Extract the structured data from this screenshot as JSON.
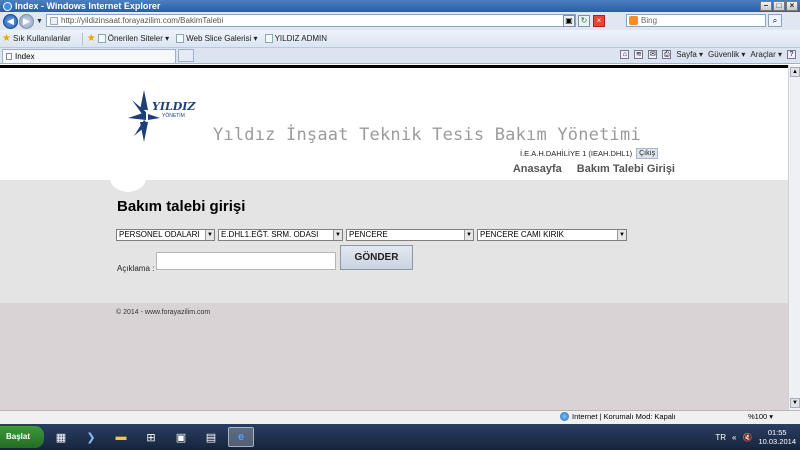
{
  "window": {
    "title": "Index - Windows Internet Explorer"
  },
  "address": {
    "url": "http://yildizinsaat.forayazilim.com/BakimTalebi",
    "search_placeholder": "Bing"
  },
  "favorites": {
    "favorites_label": "Sık Kullanılanlar",
    "items": [
      "Önerilen Siteler ▾",
      "Web Slice Galerisi ▾",
      "YILDIZ ADMIN"
    ]
  },
  "tab": {
    "label": "Index"
  },
  "commandbar": {
    "page": "Sayfa ▾",
    "safety": "Güvenlik ▾",
    "tools": "Araçlar ▾"
  },
  "page": {
    "logo_text": "YILDIZ",
    "logo_sub": "YÖNETİM",
    "site_title": "Yıldız İnşaat Teknik Tesis Bakım Yönetimi",
    "user_line": "İ.E.A.H.DAHİLİYE 1 (IEAH.DHL1)",
    "logout": "Çıkış",
    "nav": {
      "home": "Anasayfa",
      "request": "Bakım Talebi Girişi"
    },
    "form_title": "Bakım talebi girişi",
    "selects": [
      "PERSONEL ODALARI",
      "E.DHL1.EĞT. SRM. ODASI",
      "PENCERE",
      "PENCERE CAMI KIRIK"
    ],
    "description_label": "Açıklama :",
    "description_value": "",
    "submit": "GÖNDER",
    "copyright": "© 2014 - www.forayazilim.com"
  },
  "status": {
    "zone": "Internet | Korumalı Mod: Kapalı",
    "zoom": "%100 ▾"
  },
  "taskbar": {
    "start": "Başlat",
    "lang": "TR",
    "time": "01:55",
    "date": "10.03.2014"
  }
}
